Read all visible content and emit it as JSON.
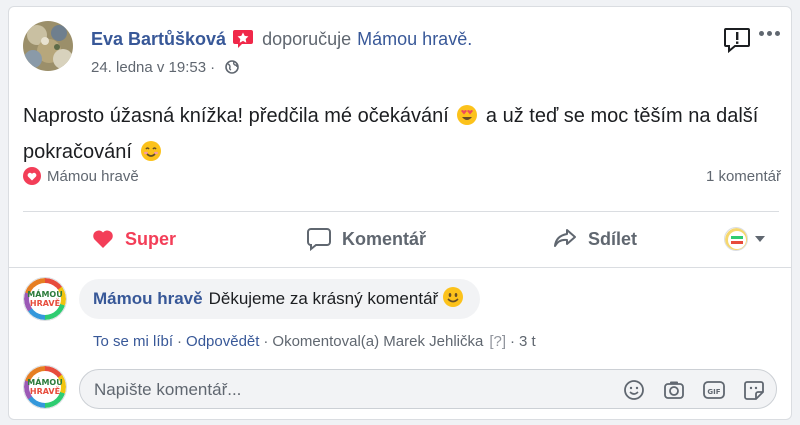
{
  "post": {
    "author": "Eva Bartůšková",
    "verb": "doporučuje",
    "page": "Mámou hravě.",
    "date": "24. ledna v 19:53",
    "dot": "·",
    "text_part1": "Naprosto úžasná knížka! předčila mé očekávání",
    "text_part2": "a už teď se moc těším na další pokračování",
    "recommend_icon": "recommendation-star-icon",
    "privacy_icon": "globe-icon"
  },
  "reactions": {
    "reactor": "Mámou hravě",
    "comment_count": "1 komentář",
    "icon": "heart-icon"
  },
  "actions": {
    "super": "Super",
    "comment": "Komentář",
    "share": "Sdílet"
  },
  "comment": {
    "author": "Mámou hravě",
    "text": "Děkujeme za krásný komentář",
    "like": "To se mi líbí",
    "reply": "Odpovědět",
    "sep": "·",
    "commented_by": "Okomentoval(a) Marek Jehlička",
    "help": "[?]",
    "age": "3 t"
  },
  "logo": {
    "line1": "MÁMOU",
    "line2": "HRAVĚ"
  },
  "composer": {
    "placeholder": "Napište komentář..."
  },
  "colors": {
    "link": "#385898",
    "super": "#f33e58",
    "muted": "#606770"
  }
}
